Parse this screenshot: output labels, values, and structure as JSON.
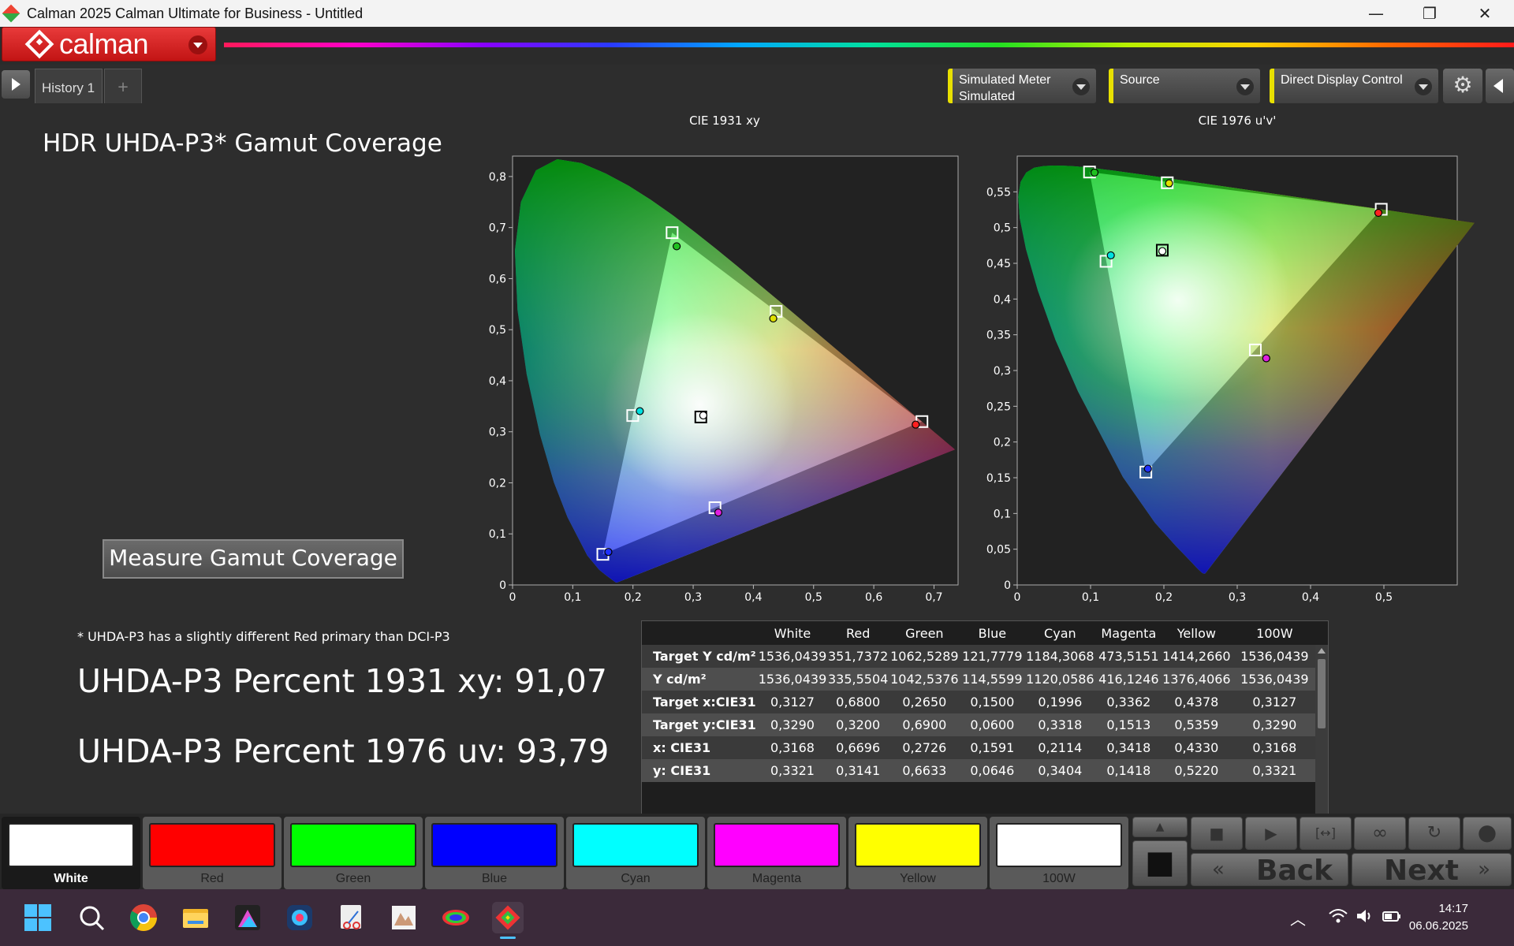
{
  "window": {
    "title": "Calman 2025 Calman Ultimate for Business  - Untitled",
    "minimize_glyph": "—",
    "restore_glyph": "❐",
    "close_glyph": "✕"
  },
  "header": {
    "logo_text": "calman"
  },
  "tabs": {
    "history_label": "History 1",
    "add_label": "+"
  },
  "combos": {
    "meter_line1": "Simulated Meter",
    "meter_line2": "Simulated",
    "source_label": "Source",
    "display_label": "Direct Display Control"
  },
  "icons": {
    "settings": "gear-icon",
    "collapse": "collapse-left-icon",
    "play": "play-icon",
    "stop": "stop-icon",
    "loop": "infinity-icon",
    "refresh": "refresh-icon"
  },
  "main": {
    "title": "HDR UHDA-P3* Gamut Coverage",
    "measure_button": "Measure Gamut Coverage",
    "footnote": "* UHDA-P3 has a slightly different Red primary than DCI-P3",
    "result_1931": "UHDA-P3 Percent 1931 xy: 91,07",
    "result_1976": "UHDA-P3 Percent 1976 uv: 93,79"
  },
  "chart_data": [
    {
      "type": "scatter",
      "title": "CIE 1931 xy",
      "xlim": [
        0,
        0.74
      ],
      "ylim": [
        0,
        0.84
      ],
      "x_ticks": [
        "0",
        "0,1",
        "0,2",
        "0,3",
        "0,4",
        "0,5",
        "0,6",
        "0,7"
      ],
      "y_ticks": [
        "0",
        "0,1",
        "0,2",
        "0,3",
        "0,4",
        "0,5",
        "0,6",
        "0,7",
        "0,8"
      ],
      "targets": [
        {
          "name": "Red",
          "x": 0.68,
          "y": 0.32
        },
        {
          "name": "Green",
          "x": 0.265,
          "y": 0.69
        },
        {
          "name": "Blue",
          "x": 0.15,
          "y": 0.06
        },
        {
          "name": "Cyan",
          "x": 0.1996,
          "y": 0.3318
        },
        {
          "name": "Magenta",
          "x": 0.3362,
          "y": 0.1513
        },
        {
          "name": "Yellow",
          "x": 0.4378,
          "y": 0.5359
        },
        {
          "name": "White",
          "x": 0.3127,
          "y": 0.329
        }
      ],
      "measured": [
        {
          "name": "Red",
          "x": 0.6696,
          "y": 0.3141,
          "color": "#ff2020"
        },
        {
          "name": "Green",
          "x": 0.2726,
          "y": 0.6633,
          "color": "#20c020"
        },
        {
          "name": "Blue",
          "x": 0.1591,
          "y": 0.0646,
          "color": "#2030ff"
        },
        {
          "name": "Cyan",
          "x": 0.2114,
          "y": 0.3404,
          "color": "#00e0e0"
        },
        {
          "name": "Magenta",
          "x": 0.3418,
          "y": 0.1418,
          "color": "#e020e0"
        },
        {
          "name": "Yellow",
          "x": 0.433,
          "y": 0.522,
          "color": "#e0e000"
        },
        {
          "name": "White",
          "x": 0.3168,
          "y": 0.3321,
          "color": "#ffffff"
        }
      ]
    },
    {
      "type": "scatter",
      "title": "CIE 1976 u'v'",
      "xlim": [
        0,
        0.6
      ],
      "ylim": [
        0,
        0.6
      ],
      "x_ticks": [
        "0",
        "0,1",
        "0,2",
        "0,3",
        "0,4",
        "0,5"
      ],
      "y_ticks": [
        "0",
        "0,05",
        "0,1",
        "0,15",
        "0,2",
        "0,25",
        "0,3",
        "0,35",
        "0,4",
        "0,45",
        "0,5",
        "0,55"
      ],
      "targets": [
        {
          "name": "Red",
          "x": 0.4964,
          "y": 0.5256
        },
        {
          "name": "Green",
          "x": 0.0986,
          "y": 0.5777
        },
        {
          "name": "Blue",
          "x": 0.1754,
          "y": 0.1579
        },
        {
          "name": "Cyan",
          "x": 0.1211,
          "y": 0.4528
        },
        {
          "name": "Magenta",
          "x": 0.3247,
          "y": 0.3288
        },
        {
          "name": "Yellow",
          "x": 0.2046,
          "y": 0.5627
        },
        {
          "name": "White",
          "x": 0.1978,
          "y": 0.4683
        }
      ],
      "measured": [
        {
          "name": "Red",
          "x": 0.4925,
          "y": 0.5206,
          "color": "#ff2020"
        },
        {
          "name": "Green",
          "x": 0.1054,
          "y": 0.5769,
          "color": "#20c020"
        },
        {
          "name": "Blue",
          "x": 0.1782,
          "y": 0.1626,
          "color": "#2030ff"
        },
        {
          "name": "Cyan",
          "x": 0.1276,
          "y": 0.4611,
          "color": "#00e0e0"
        },
        {
          "name": "Magenta",
          "x": 0.3396,
          "y": 0.3171,
          "color": "#e020e0"
        },
        {
          "name": "Yellow",
          "x": 0.2071,
          "y": 0.5619,
          "color": "#e0e000"
        },
        {
          "name": "White",
          "x": 0.1979,
          "y": 0.467,
          "color": "#ffffff"
        }
      ]
    }
  ],
  "table": {
    "columns": [
      "",
      "White",
      "Red",
      "Green",
      "Blue",
      "Cyan",
      "Magenta",
      "Yellow",
      "100W"
    ],
    "rows": [
      [
        "Target Y cd/m²",
        "1536,0439",
        "351,7372",
        "1062,5289",
        "121,7779",
        "1184,3068",
        "473,5151",
        "1414,2660",
        "1536,0439"
      ],
      [
        "Y cd/m²",
        "1536,0439",
        "335,5504",
        "1042,5376",
        "114,5599",
        "1120,0586",
        "416,1246",
        "1376,4066",
        "1536,0439"
      ],
      [
        "Target x:CIE31",
        "0,3127",
        "0,6800",
        "0,2650",
        "0,1500",
        "0,1996",
        "0,3362",
        "0,4378",
        "0,3127"
      ],
      [
        "Target y:CIE31",
        "0,3290",
        "0,3200",
        "0,6900",
        "0,0600",
        "0,3318",
        "0,1513",
        "0,5359",
        "0,3290"
      ],
      [
        "x: CIE31",
        "0,3168",
        "0,6696",
        "0,2726",
        "0,1591",
        "0,2114",
        "0,3418",
        "0,4330",
        "0,3168"
      ],
      [
        "y: CIE31",
        "0,3321",
        "0,3141",
        "0,6633",
        "0,0646",
        "0,3404",
        "0,1418",
        "0,5220",
        "0,3321"
      ]
    ]
  },
  "patches": [
    {
      "label": "White",
      "color": "#ffffff"
    },
    {
      "label": "Red",
      "color": "#ff0000"
    },
    {
      "label": "Green",
      "color": "#00ff00"
    },
    {
      "label": "Blue",
      "color": "#0000ff"
    },
    {
      "label": "Cyan",
      "color": "#00ffff"
    },
    {
      "label": "Magenta",
      "color": "#ff00ff"
    },
    {
      "label": "Yellow",
      "color": "#ffff00"
    },
    {
      "label": "100W",
      "color": "#ffffff"
    }
  ],
  "nav": {
    "back_label": "Back",
    "next_label": "Next"
  },
  "taskbar": {
    "time": "14:17",
    "date": "06.06.2025"
  }
}
